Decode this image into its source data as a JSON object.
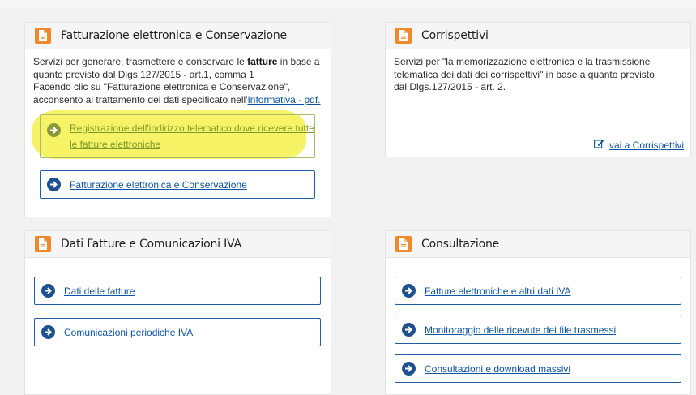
{
  "panels": {
    "fatturazione": {
      "title": "Fatturazione elettronica e Conservazione",
      "desc_1": "Servizi per generare, trasmettere e conservare le ",
      "desc_bold": "fatture",
      "desc_2": " in base a quanto previsto dal Dlgs.127/2015 - art.1, comma 1",
      "desc_3": "Facendo clic su \"Fatturazione elettronica e Conservazione\", acconsento al trattamento dei dati specificato nell'",
      "desc_link": "Informativa - pdf.",
      "buttons": [
        {
          "label": "Registrazione dell'indirizzo telematico dove ricevere tutte le fatture elettroniche"
        },
        {
          "label": "Fatturazione elettronica e Conservazione"
        }
      ]
    },
    "corrispettivi": {
      "title": "Corrispettivi",
      "desc": "Servizi per \"la memorizzazione elettronica e la trasmissione telematica dei dati dei corrispettivi\" in base a quanto previsto dal Dlgs.127/2015 - art. 2.",
      "link": "vai a Corrispettivi"
    },
    "dati_fatture": {
      "title": "Dati Fatture e Comunicazioni IVA",
      "buttons": [
        {
          "label": "Dati delle fatture"
        },
        {
          "label": "Comunicazioni periodiche IVA"
        }
      ]
    },
    "consultazione": {
      "title": "Consultazione",
      "buttons": [
        {
          "label": "Fatture elettroniche e altri dati IVA"
        },
        {
          "label": "Monitoraggio delle ricevute dei file trasmessi"
        },
        {
          "label": "Consultazioni e download massivi"
        }
      ]
    }
  },
  "colors": {
    "accent_orange": "#f0892b",
    "link_blue": "#0b55a8",
    "button_border": "#1e5ea8",
    "highlight_yellow": "#f5f03c"
  }
}
